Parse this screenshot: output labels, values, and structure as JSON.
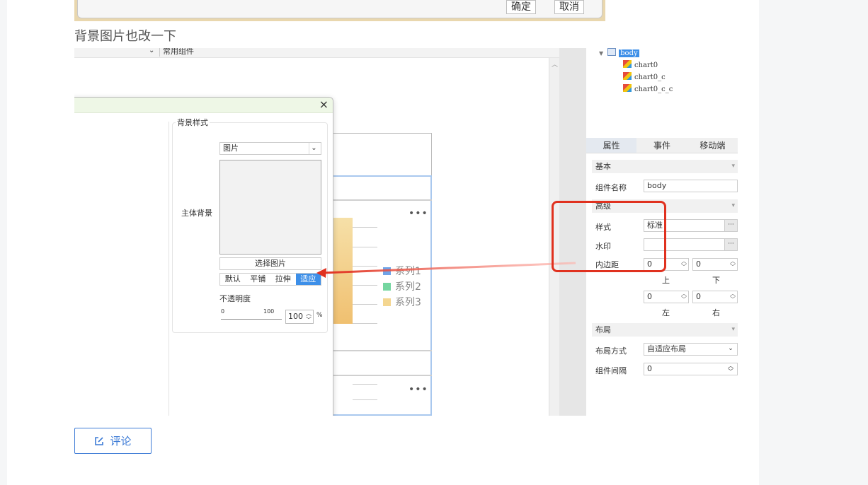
{
  "top_dialog": {
    "ok_label": "确定",
    "cancel_label": "取消"
  },
  "caption": "背景图片也改一下",
  "editor": {
    "toolbar_partial_label": "常用组件",
    "legend": [
      {
        "name": "系列1",
        "color": "#6fa3e8"
      },
      {
        "name": "系列2",
        "color": "#74d6a0"
      },
      {
        "name": "系列3",
        "color": "#f4d690"
      }
    ],
    "more_dots": "•••"
  },
  "bg_dialog": {
    "close_glyph": "×",
    "group_title": "背景样式",
    "main_bg_label": "主体背景",
    "type_value": "图片",
    "choose_image_label": "选择图片",
    "modes": [
      "默认",
      "平铺",
      "拉伸",
      "适应"
    ],
    "active_mode": "适应",
    "opacity_label": "不透明度",
    "slider_min": "0",
    "slider_max": "100",
    "opacity_value": "100",
    "percent": "%"
  },
  "tree": {
    "root": "body",
    "children": [
      "chart0",
      "chart0_c",
      "chart0_c_c"
    ]
  },
  "props": {
    "tabs": [
      "属性",
      "事件",
      "移动端"
    ],
    "section_basic": "基本",
    "component_name_label": "组件名称",
    "component_name_value": "body",
    "section_advanced": "高级",
    "style_label": "样式",
    "style_value": "标准",
    "watermark_label": "水印",
    "padding_label": "内边距",
    "padding_top": "0",
    "padding_bottom": "0",
    "padding_left": "0",
    "padding_right": "0",
    "cap_top": "上",
    "cap_bottom": "下",
    "cap_left": "左",
    "cap_right": "右",
    "section_layout": "布局",
    "layout_mode_label": "布局方式",
    "layout_mode_value": "自适应布局",
    "gap_label": "组件间隔",
    "gap_value": "0"
  },
  "comment_button": "评论"
}
